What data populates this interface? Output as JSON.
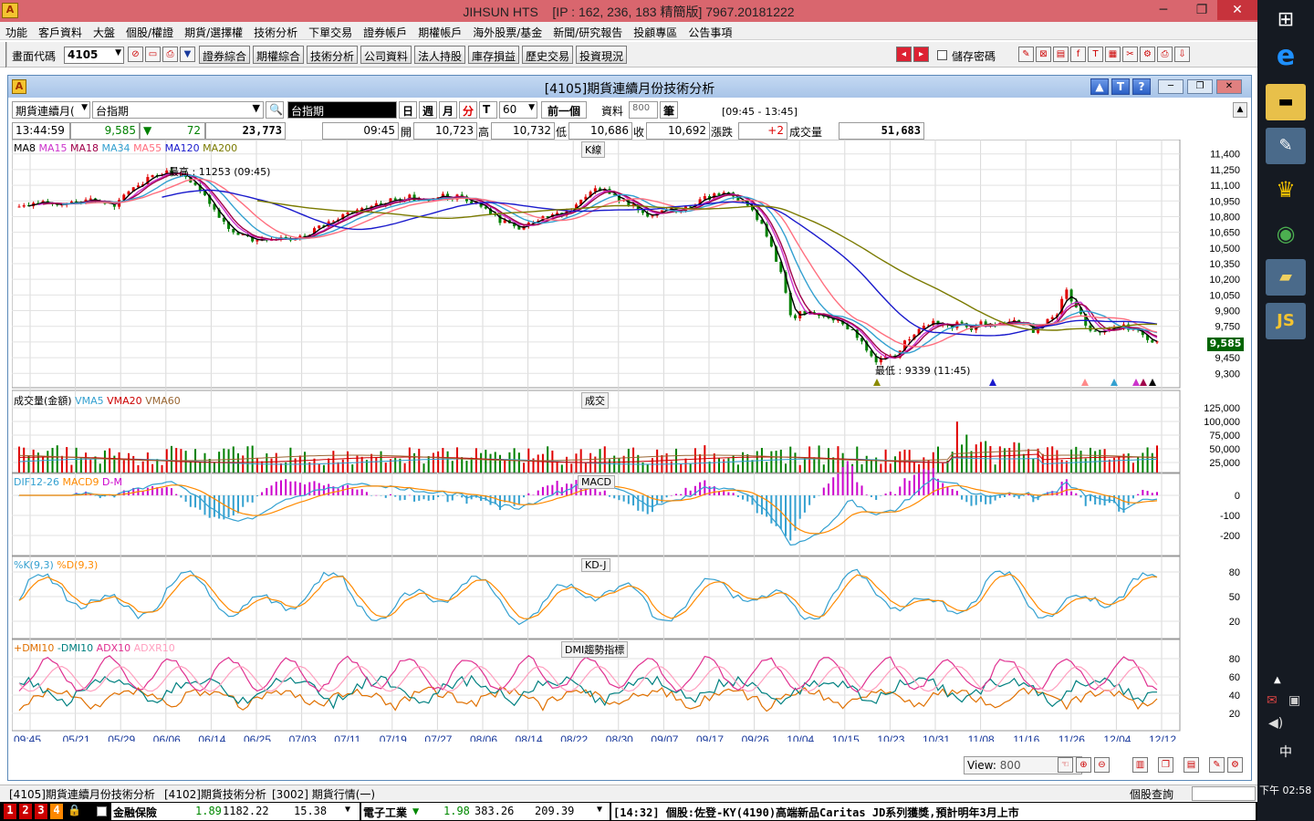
{
  "window": {
    "app": "JIHSUN HTS",
    "version": "[IP : 162, 236, 183 精簡版] 7967.20181222",
    "min": "─",
    "restore": "❐",
    "close": "✕"
  },
  "menu": [
    "功能",
    "客戶資料",
    "大盤",
    "個股/權證",
    "期貨/選擇權",
    "技術分析",
    "下單交易",
    "證券帳戶",
    "期權帳戶",
    "海外股票/基金",
    "新聞/研究報告",
    "投顧專區",
    "公告事項"
  ],
  "toolbar": {
    "code_label": "畫面代碼",
    "code_value": "4105",
    "buttons": [
      "證券綜合",
      "期權綜合",
      "技術分析",
      "公司資料",
      "法人持股",
      "庫存損益",
      "歷史交易",
      "投資現況"
    ],
    "save_pwd": "儲存密碼"
  },
  "inner": {
    "title": "[4105]期貨連續月份技術分析",
    "product_select": "期貨連續月(",
    "product_name": "台指期",
    "product_tag": "台指期",
    "periods": [
      "日",
      "週",
      "月",
      "分",
      "T"
    ],
    "minute_value": "60",
    "prev_btn": "前一個",
    "data_label": "資料",
    "data_value": "800",
    "unit_btn": "筆",
    "time_range": "[09:45 - 13:45]",
    "quote": {
      "time": "13:44:59",
      "last": "9,585",
      "arrow": "▼",
      "change": "72",
      "volume_total": "23,773",
      "bar_time": "09:45",
      "open_label": "開",
      "open": "10,723",
      "high_label": "高",
      "high": "10,732",
      "low_label": "低",
      "low": "10,686",
      "close_label": "收",
      "close": "10,692",
      "chg_label": "漲跌",
      "chg": "+2",
      "vol_label": "成交量",
      "vol": "51,683"
    }
  },
  "chart_data": {
    "type": "candlestick",
    "panels": [
      {
        "name": "K線",
        "legend": [
          "MA8",
          "MA15",
          "MA18",
          "MA34",
          "MA55",
          "MA120",
          "MA200"
        ],
        "legend_colors": [
          "#000000",
          "#cc33cc",
          "#a0004a",
          "#33a0d0",
          "#ff6f7f",
          "#1a1acc",
          "#7a7a00"
        ],
        "yticks": [
          "11,400",
          "11,250",
          "11,100",
          "10,950",
          "10,800",
          "10,650",
          "10,500",
          "10,350",
          "10,200",
          "10,050",
          "9,900",
          "9,750",
          "9,600",
          "9,450",
          "9,300"
        ],
        "ytick_values": [
          11400,
          11250,
          11100,
          10950,
          10800,
          10650,
          10500,
          10350,
          10200,
          10050,
          9900,
          9750,
          9600,
          9450,
          9300
        ],
        "last_price": "9,585",
        "last_value": 9585,
        "high_note": "最高 : 11253 (09:45)",
        "high_value": 11253,
        "low_note": "最低 : 9339 (11:45)",
        "low_value": 9339,
        "close_path": [
          [
            0,
            10880
          ],
          [
            0.02,
            10950
          ],
          [
            0.05,
            10930
          ],
          [
            0.08,
            10970
          ],
          [
            0.1,
            10900
          ],
          [
            0.12,
            11050
          ],
          [
            0.14,
            11190
          ],
          [
            0.16,
            11240
          ],
          [
            0.18,
            11160
          ],
          [
            0.2,
            10980
          ],
          [
            0.22,
            10700
          ],
          [
            0.25,
            10560
          ],
          [
            0.27,
            10600
          ],
          [
            0.29,
            10580
          ],
          [
            0.31,
            10650
          ],
          [
            0.33,
            10750
          ],
          [
            0.35,
            10850
          ],
          [
            0.37,
            10880
          ],
          [
            0.39,
            10950
          ],
          [
            0.41,
            10990
          ],
          [
            0.43,
            10960
          ],
          [
            0.45,
            11000
          ],
          [
            0.47,
            10980
          ],
          [
            0.49,
            10900
          ],
          [
            0.51,
            10750
          ],
          [
            0.53,
            10700
          ],
          [
            0.55,
            10760
          ],
          [
            0.57,
            10820
          ],
          [
            0.59,
            10880
          ],
          [
            0.61,
            11100
          ],
          [
            0.63,
            11000
          ],
          [
            0.65,
            10900
          ],
          [
            0.67,
            10810
          ],
          [
            0.69,
            10850
          ],
          [
            0.71,
            10900
          ],
          [
            0.73,
            10980
          ],
          [
            0.75,
            11020
          ],
          [
            0.77,
            10950
          ],
          [
            0.79,
            10700
          ],
          [
            0.81,
            10200
          ],
          [
            0.82,
            9800
          ],
          [
            0.83,
            9900
          ],
          [
            0.85,
            9850
          ],
          [
            0.87,
            9780
          ],
          [
            0.89,
            9650
          ],
          [
            0.91,
            9400
          ],
          [
            0.93,
            9480
          ],
          [
            0.95,
            9700
          ],
          [
            0.97,
            9800
          ],
          [
            0.99,
            9760
          ]
        ],
        "close_path_tail": [
          [
            0,
            9760
          ],
          [
            0.05,
            9800
          ],
          [
            0.1,
            9720
          ],
          [
            0.15,
            9780
          ],
          [
            0.2,
            9760
          ],
          [
            0.25,
            9750
          ],
          [
            0.3,
            9790
          ],
          [
            0.35,
            9780
          ],
          [
            0.4,
            9710
          ],
          [
            0.45,
            9790
          ],
          [
            0.5,
            9820
          ],
          [
            0.55,
            10100
          ],
          [
            0.6,
            9950
          ],
          [
            0.65,
            9760
          ],
          [
            0.7,
            9700
          ],
          [
            0.75,
            9740
          ],
          [
            0.8,
            9770
          ],
          [
            0.85,
            9730
          ],
          [
            0.9,
            9720
          ],
          [
            0.95,
            9620
          ],
          [
            1,
            9585
          ]
        ]
      },
      {
        "name": "成交",
        "legend": [
          "成交量(金額)",
          "VMA5",
          "VMA20",
          "VMA60"
        ],
        "legend_colors": [
          "#000000",
          "#33a0d0",
          "#cc0000",
          "#996633"
        ],
        "yticks": [
          "125,000",
          "100,000",
          "75,000",
          "50,000",
          "25,000"
        ]
      },
      {
        "name": "MACD",
        "legend": [
          "DIF12-26",
          "MACD9",
          "D-M"
        ],
        "legend_colors": [
          "#33a0d0",
          "#ff8a00",
          "#cc00cc"
        ],
        "yticks": [
          "0",
          "-100",
          "-200"
        ]
      },
      {
        "name": "KD-J",
        "legend": [
          "%K(9,3)",
          "%D(9,3)"
        ],
        "legend_colors": [
          "#33a0d0",
          "#ff8a00"
        ],
        "yticks": [
          "80",
          "50",
          "20"
        ]
      },
      {
        "name": "DMI趨勢指標",
        "legend": [
          "+DMI10",
          "-DMI10",
          "ADX10",
          "ADXR10"
        ],
        "legend_colors": [
          "#e07000",
          "#008080",
          "#e03090",
          "#ff9fbf"
        ],
        "yticks": [
          "80",
          "60",
          "40",
          "20"
        ]
      }
    ],
    "xticks": [
      "09:45",
      "05/21",
      "05/29",
      "06/06",
      "06/14",
      "06/25",
      "07/03",
      "07/11",
      "07/19",
      "07/27",
      "08/06",
      "08/14",
      "08/22",
      "08/30",
      "09/07",
      "09/17",
      "09/26",
      "10/04",
      "10/15",
      "10/23",
      "10/31",
      "11/08",
      "11/16",
      "11/26",
      "12/04",
      "12/12"
    ],
    "view_label": "View:",
    "view_value": "800"
  },
  "tabs": [
    "[4105]期貨連續月份技術分析",
    "[4102]期貨技術分析",
    "[3002] 期貨行情(一)"
  ],
  "stock_query": "個股查詢",
  "ticker": {
    "nums": [
      "1",
      "2",
      "3",
      "4"
    ],
    "sector1": "金融保險",
    "s1_chg": "1.89",
    "s1_idx": "1182.22",
    "s1_val": "15.38",
    "sector2": "電子工業",
    "s2_chg": "1.98",
    "s2_idx": "383.26",
    "s2_val": "209.39",
    "news": "[14:32] 個股:佐登-KY(4190)高端新品Caritas JD系列獲獎,預計明年3月上市"
  },
  "taskbar": {
    "lang": "中",
    "time": "下午 02:58"
  }
}
